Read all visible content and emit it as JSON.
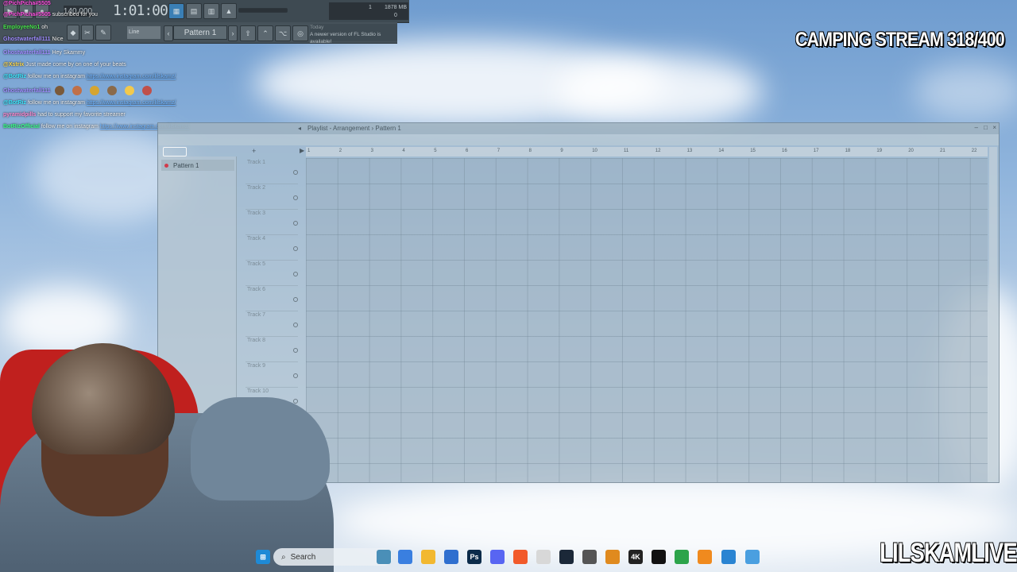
{
  "fl_toolbar": {
    "tempo": "140.000",
    "time": "1:01:00",
    "cpu_top": "1",
    "memory": "1878 MB",
    "cpu_bottom": "0",
    "line_select": "Line",
    "pattern_select": "Pattern 1",
    "news_date": "Today",
    "news_text": "A newer version of FL Studio is available!"
  },
  "chat": [
    {
      "name": "@PichPicha#5505",
      "msg": "",
      "color": "#ff4ee0"
    },
    {
      "name": "@PichPicha#5505",
      "msg": "subscribed for you",
      "color": "#ff4ee0"
    },
    {
      "name": "EmployeeNo1",
      "msg": "oh",
      "color": "#48e44c"
    },
    {
      "name": "Ghostwaterfall111",
      "msg": "Nice",
      "color": "#9f8cff"
    },
    {
      "name": "Ghostwaterfall111",
      "msg": "Hey Skammy",
      "color": "#9f8cff"
    },
    {
      "name": "@Xstrix",
      "msg": "Just made come by on one of your beats",
      "color": "#ffd84a"
    },
    {
      "name": "@BotRiz",
      "msg": "follow me on instagram ",
      "link": "https://www.instagram.com/lilskamz/",
      "color": "#3be9ff"
    },
    {
      "name": "Ghostwaterfall111",
      "msg": "",
      "color": "#9f8cff"
    },
    {
      "name": "@BotRiz",
      "msg": "follow me on instagram ",
      "link": "https://www.instagram.com/lilskamz/",
      "color": "#3be9ff"
    },
    {
      "name": "pyramidpills",
      "msg": "had to support my favorite streamer",
      "color": "#ff8bd2"
    },
    {
      "name": "BotRizOfficial",
      "msg": "follow me on instagram ",
      "link": "https://www.instagram.com/lilskamz/",
      "color": "#3bff8a"
    }
  ],
  "playlist": {
    "title": "Playlist - Arrangement",
    "separator": "›",
    "pattern": "Pattern 1",
    "pattern_item": "Pattern 1",
    "ruler": [
      "1",
      "2",
      "3",
      "4",
      "5",
      "6",
      "7",
      "8",
      "9",
      "10",
      "11",
      "12",
      "13",
      "14",
      "15",
      "16",
      "17",
      "18",
      "19",
      "20",
      "21",
      "22"
    ],
    "tracks": [
      "Track 1",
      "Track 2",
      "Track 3",
      "Track 4",
      "Track 5",
      "Track 6",
      "Track 7",
      "Track 8",
      "Track 9",
      "Track 10"
    ]
  },
  "overlay": {
    "title": "CAMPING STREAM 318/400",
    "brand": "LILSKAMLIVE"
  },
  "taskbar": {
    "search_label": "Search",
    "icons": [
      "windows-icon",
      "search-icon",
      "widgets-icon",
      "copilot-icon",
      "file-explorer-icon",
      "microsoft-store-icon",
      "photoshop-icon",
      "discord-icon",
      "brave-icon",
      "chrome-icon",
      "steam-icon",
      "app-icon",
      "vlc-icon",
      "4k-downloader-icon",
      "capcut-icon",
      "app-green-icon",
      "fl-studio-icon",
      "visual-studio-icon",
      "notepad-icon"
    ]
  }
}
